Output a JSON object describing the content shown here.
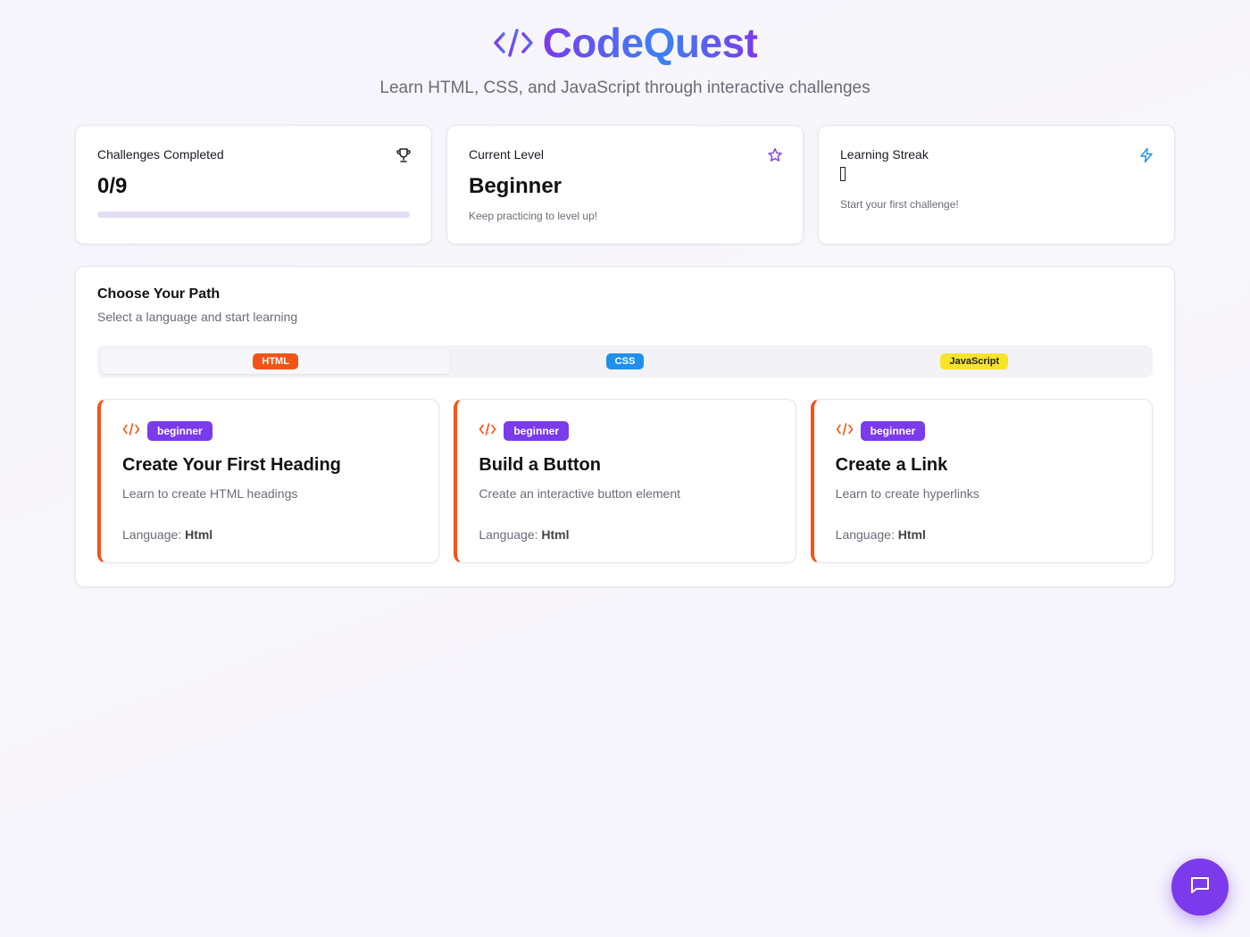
{
  "header": {
    "title": "CodeQuest",
    "tagline": "Learn HTML, CSS, and JavaScript through interactive challenges",
    "logo_icon": "code-icon"
  },
  "stats": [
    {
      "title": "Challenges Completed",
      "value": "0/9",
      "icon": "trophy-icon",
      "progress": 0.0
    },
    {
      "title": "Current Level",
      "value": "Beginner",
      "subtitle": "Keep practicing to level up!",
      "icon": "star-icon"
    },
    {
      "title": "Learning Streak",
      "subtitle": "Start your first challenge!",
      "icon": "lightning-icon"
    }
  ],
  "path": {
    "title": "Choose Your Path",
    "subtitle": "Select a language and start learning",
    "tabs": [
      {
        "label": "HTML",
        "color": "#f25418",
        "active": true
      },
      {
        "label": "CSS",
        "color": "#2090ee",
        "active": false
      },
      {
        "label": "JavaScript",
        "color": "#f7e42a",
        "active": false
      }
    ]
  },
  "challenges": [
    {
      "level": "beginner",
      "title": "Create Your First Heading",
      "description": "Learn to create HTML headings",
      "language_label": "Language:",
      "language": "Html"
    },
    {
      "level": "beginner",
      "title": "Build a Button",
      "description": "Create an interactive button element",
      "language_label": "Language:",
      "language": "Html"
    },
    {
      "level": "beginner",
      "title": "Create a Link",
      "description": "Learn to create hyperlinks",
      "language_label": "Language:",
      "language": "Html"
    }
  ],
  "colors": {
    "accent": "#7c3aed",
    "html": "#f25418",
    "css": "#2090ee",
    "js": "#f7e42a"
  },
  "chat_button": {
    "icon": "chat-icon"
  }
}
